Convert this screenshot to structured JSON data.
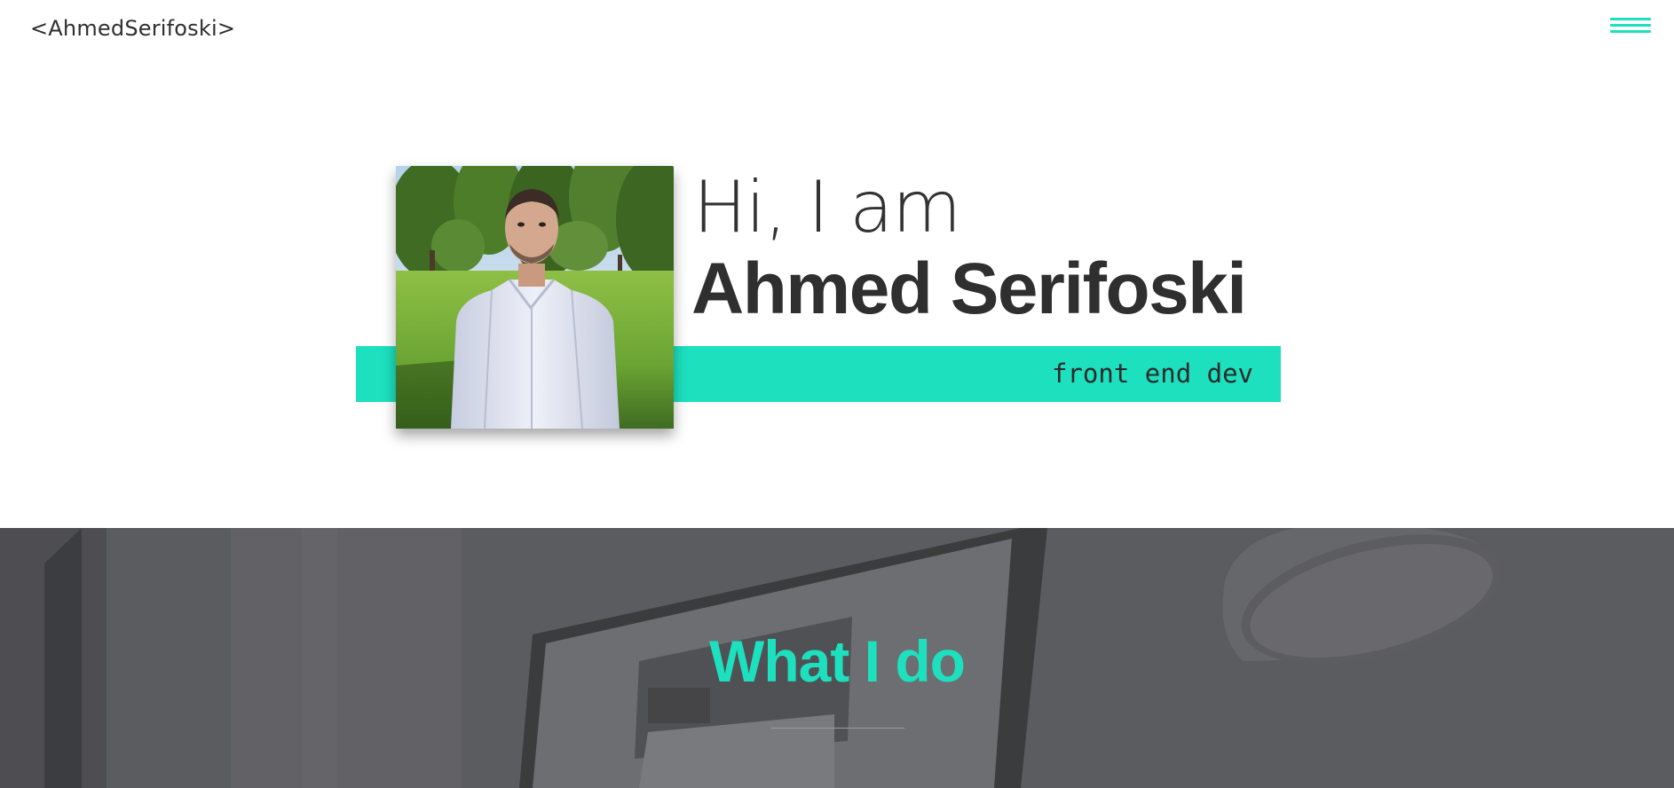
{
  "header": {
    "logo_text": "<AhmedSerifoski>",
    "menu_icon": "hamburger-icon"
  },
  "hero": {
    "greeting": "Hi, I am",
    "name": "Ahmed Serifoski",
    "role": "front end dev"
  },
  "what_i_do": {
    "title": "What I do"
  },
  "colors": {
    "accent": "#1de0be",
    "text_dark": "#2f2f2f",
    "section_bg": "#5d5e62"
  }
}
